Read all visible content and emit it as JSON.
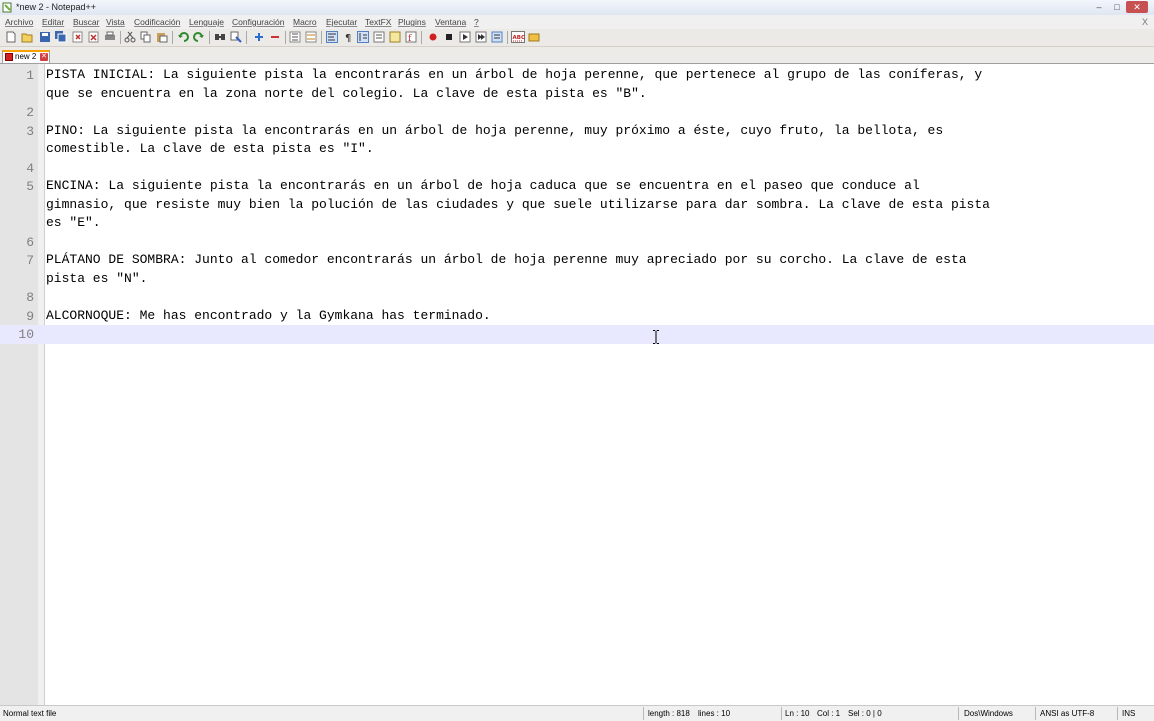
{
  "window": {
    "title": "*new  2 - Notepad++",
    "controls": [
      "minimize",
      "maximize",
      "close"
    ]
  },
  "menu": {
    "items": [
      "Archivo",
      "Editar",
      "Buscar",
      "Vista",
      "Codificación",
      "Lenguaje",
      "Configuración",
      "Macro",
      "Ejecutar",
      "TextFX",
      "Plugins",
      "Ventana",
      "?"
    ],
    "close": "X"
  },
  "toolbar": {
    "icons": [
      "new-file-icon",
      "open-file-icon",
      "save-icon",
      "save-all-icon",
      "close-icon",
      "close-all-icon",
      "print-icon",
      "cut-icon",
      "copy-icon",
      "paste-icon",
      "undo-icon",
      "redo-icon",
      "find-icon",
      "replace-icon",
      "zoom-in-icon",
      "zoom-out-icon",
      "sync-v-icon",
      "sync-h-icon",
      "word-wrap-icon",
      "show-all-chars-icon",
      "indent-guide-icon",
      "udl-icon",
      "doc-map-icon",
      "function-list-icon",
      "record-macro-icon",
      "stop-macro-icon",
      "play-macro-icon",
      "play-multi-macro-icon",
      "save-macro-icon",
      "spellcheck-icon",
      "plugin-icon"
    ]
  },
  "tab": {
    "label": "new  2"
  },
  "editor": {
    "lines": [
      {
        "num": "1",
        "text": "PISTA INICIAL: La siguiente pista la encontrarás en un árbol de hoja perenne, que pertenece al grupo de las coníferas, y"
      },
      {
        "num": "",
        "text": "que se encuentra en la zona norte del colegio. La clave de esta pista es \"B\"."
      },
      {
        "num": "2",
        "text": ""
      },
      {
        "num": "3",
        "text": "PINO: La siguiente pista la encontrarás en un árbol de hoja perenne, muy próximo a éste, cuyo fruto, la bellota, es"
      },
      {
        "num": "",
        "text": "comestible. La clave de esta pista es \"I\"."
      },
      {
        "num": "4",
        "text": ""
      },
      {
        "num": "5",
        "text": "ENCINA: La siguiente pista la encontrarás en un árbol de hoja caduca que se encuentra en el paseo que conduce al"
      },
      {
        "num": "",
        "text": "gimnasio, que resiste muy bien la polución de las ciudades y que suele utilizarse para dar sombra. La clave de esta pista"
      },
      {
        "num": "",
        "text": "es \"E\"."
      },
      {
        "num": "6",
        "text": ""
      },
      {
        "num": "7",
        "text": "PLÁTANO DE SOMBRA: Junto al comedor encontrarás un árbol de hoja perenne muy apreciado por su corcho. La clave de esta"
      },
      {
        "num": "",
        "text": "pista es \"N\"."
      },
      {
        "num": "8",
        "text": ""
      },
      {
        "num": "9",
        "text": "ALCORNOQUE: Me has encontrado y la Gymkana has terminado."
      },
      {
        "num": "10",
        "text": ""
      }
    ],
    "current_line_index": 14
  },
  "status": {
    "file_type": "Normal text file",
    "length": "length : 818",
    "lines": "lines : 10",
    "ln": "Ln : 10",
    "col": "Col : 1",
    "sel": "Sel : 0 | 0",
    "eol": "Dos\\Windows",
    "encoding": "ANSI as UTF-8",
    "mode": "INS"
  }
}
